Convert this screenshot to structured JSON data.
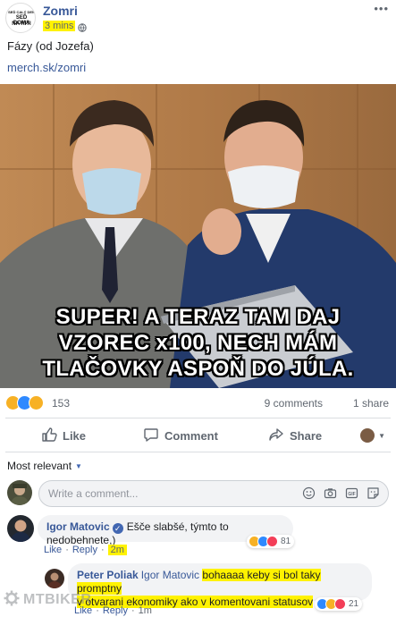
{
  "post": {
    "page_name": "Zomri",
    "avatar_lines": [
      "SEĎ CALÝ DEŇ",
      "SEĎ DOMA",
      "NA RITI"
    ],
    "time": "3 mins",
    "text": "Fázy (od Jozefa)",
    "link": "merch.sk/zomri",
    "meme_caption": [
      "SUPER! A TERAZ TAM DAJ",
      "VZOREC x100, NECH MÁM",
      "TLAČOVKY ASPOŇ DO JÚLA."
    ]
  },
  "stats": {
    "reaction_count": "153",
    "comments": "9 comments",
    "shares": "1 share"
  },
  "actions": {
    "like": "Like",
    "comment": "Comment",
    "share": "Share"
  },
  "comments_section": {
    "sort_label": "Most relevant",
    "composer_placeholder": "Write a comment...",
    "comments": [
      {
        "author": "Igor Matovic",
        "text": "Ešče slabšé, týmto to nedobehnete,)",
        "like": "Like",
        "reply": "Reply",
        "time": "2m",
        "react_count": "81"
      },
      {
        "author": "Peter Poliak",
        "mention": "Igor Matovic",
        "text_line1": "bohaaaa keby si bol taky promptny",
        "text_line2": "v otvarani ekonomiky ako v komentovani statusov",
        "like": "Like",
        "reply": "Reply",
        "time": "1m",
        "react_count": "21"
      }
    ]
  },
  "watermark": "MTBIKER",
  "colors": {
    "facebook_blue": "#385898",
    "highlight_yellow": "#fff200",
    "meta_gray": "#606770"
  }
}
